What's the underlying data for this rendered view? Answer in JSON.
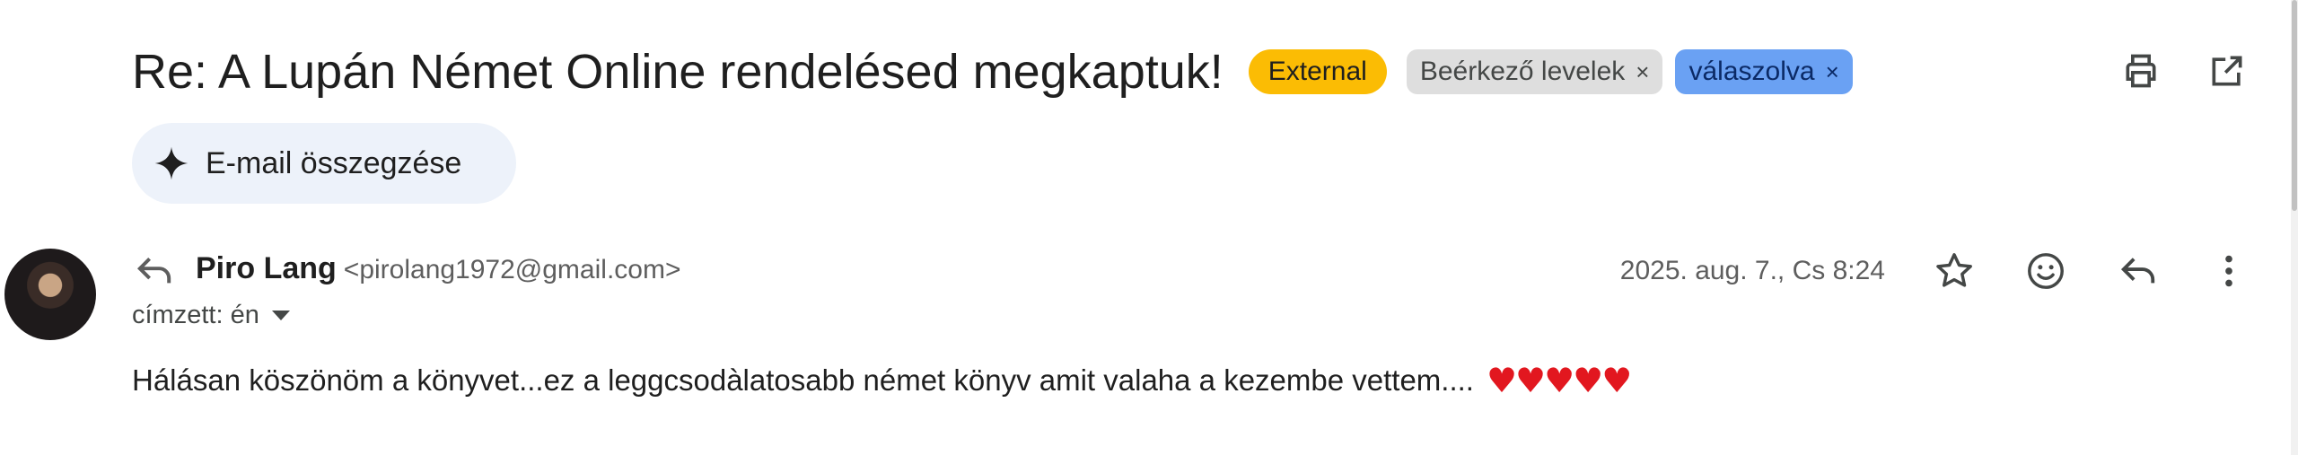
{
  "email": {
    "subject": "Re: A Lupán Német Online rendelésed megkaptuk!",
    "labels": {
      "external": "External",
      "inbox": "Beérkező levelek",
      "replied": "válaszolva",
      "remove_glyph": "×"
    },
    "summary_button": {
      "label": "E-mail összegzése",
      "icon": "sparkle-icon"
    },
    "toolbar_icons": [
      "print-icon",
      "open-in-new-window-icon"
    ],
    "message": {
      "sender_name": "Piro Lang",
      "sender_email": "<pirolang1972@gmail.com>",
      "recipient": "címzett: én",
      "date": "2025. aug. 7., Cs 8:24",
      "body": "Hálásan köszönöm a könyvet...ez a leggcsodàlatosabb német könyv amit valaha a kezembe vettem....",
      "hearts": "♥♥♥♥♥",
      "actions": [
        "star-icon",
        "emoji-reaction-icon",
        "reply-icon",
        "more-options-icon"
      ]
    },
    "colors": {
      "external_chip": "#fbbc04",
      "inbox_chip": "#dedede",
      "replied_chip": "#6aa1f3",
      "summary_bg": "#edf2fa",
      "heart": "#e2171f"
    }
  }
}
